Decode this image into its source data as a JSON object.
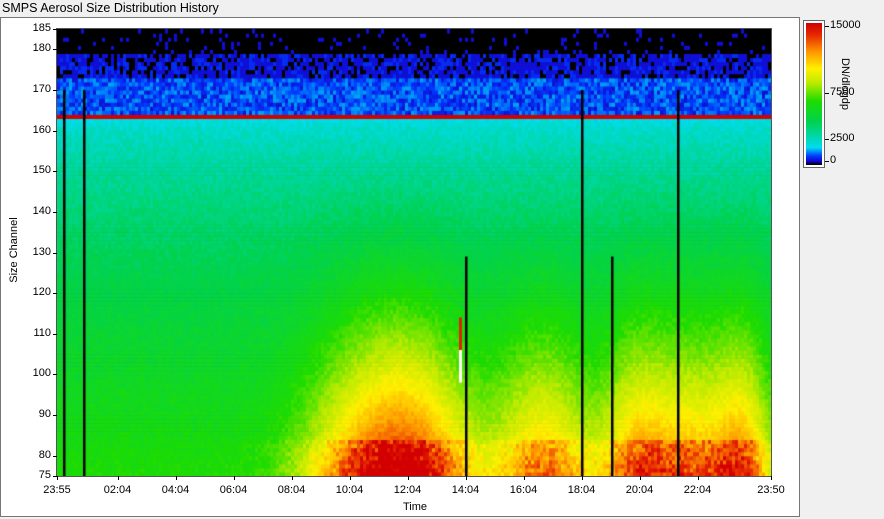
{
  "window_title": "SMPS Aerosol Size Distribution History",
  "chart_data": {
    "type": "heatmap",
    "title": "SMPS Aerosol Size Distribution History",
    "xlabel": "Time",
    "ylabel": "Size Channel",
    "x_ticks": [
      "23:55",
      "02:04",
      "04:04",
      "06:04",
      "08:04",
      "10:04",
      "12:04",
      "14:04",
      "16:04",
      "18:04",
      "20:04",
      "22:04",
      "23:50"
    ],
    "y_ticks": [
      75,
      80,
      90,
      100,
      110,
      120,
      130,
      140,
      150,
      160,
      170,
      180,
      185
    ],
    "ylim": [
      75,
      185
    ],
    "colorbar_label": "DN/dlogdp",
    "colorbar_ticks": [
      "15000",
      "7500",
      "2500",
      "0"
    ],
    "colorscale": [
      "#000000",
      "#0000ff",
      "#00e5ff",
      "#00dd00",
      "#ffff00",
      "#ff8800",
      "#ff0000",
      "#ffffff"
    ],
    "gaps_time": [
      "00:08",
      "00:42",
      "13:33",
      "17:25",
      "18:27",
      "20:42"
    ]
  }
}
